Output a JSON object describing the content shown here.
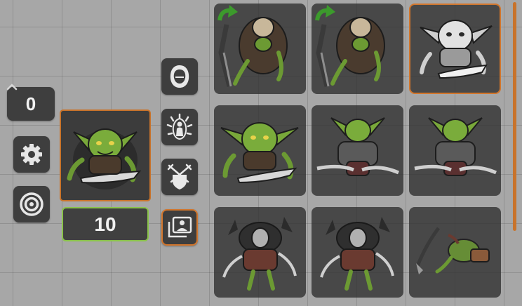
{
  "counter": {
    "value": "0"
  },
  "selection": {
    "count": "10"
  },
  "colors": {
    "accent_orange": "#d2762c",
    "accent_green": "#8ac34a",
    "panel_dark": "#3e3e3e",
    "goblin_green": "#79a83a"
  },
  "left_tools": [
    {
      "icon": "settings-gear-icon"
    },
    {
      "icon": "target-icon"
    }
  ],
  "side_tools": [
    {
      "icon": "hooded-figure-icon"
    },
    {
      "icon": "aura-figure-icon"
    },
    {
      "icon": "crossed-swords-shield-icon"
    },
    {
      "icon": "portrait-gallery-icon",
      "active": true
    }
  ],
  "token_grid": [
    {
      "name": "goblin-archer-variant",
      "has_arrow": true
    },
    {
      "name": "goblin-archer-variant",
      "has_arrow": true
    },
    {
      "name": "goblin-grey",
      "selected": true
    },
    {
      "name": "goblin-plain"
    },
    {
      "name": "goblin-armored"
    },
    {
      "name": "goblin-armored"
    },
    {
      "name": "goblin-warrior"
    },
    {
      "name": "goblin-warrior"
    },
    {
      "name": "goblin-fallen"
    }
  ]
}
